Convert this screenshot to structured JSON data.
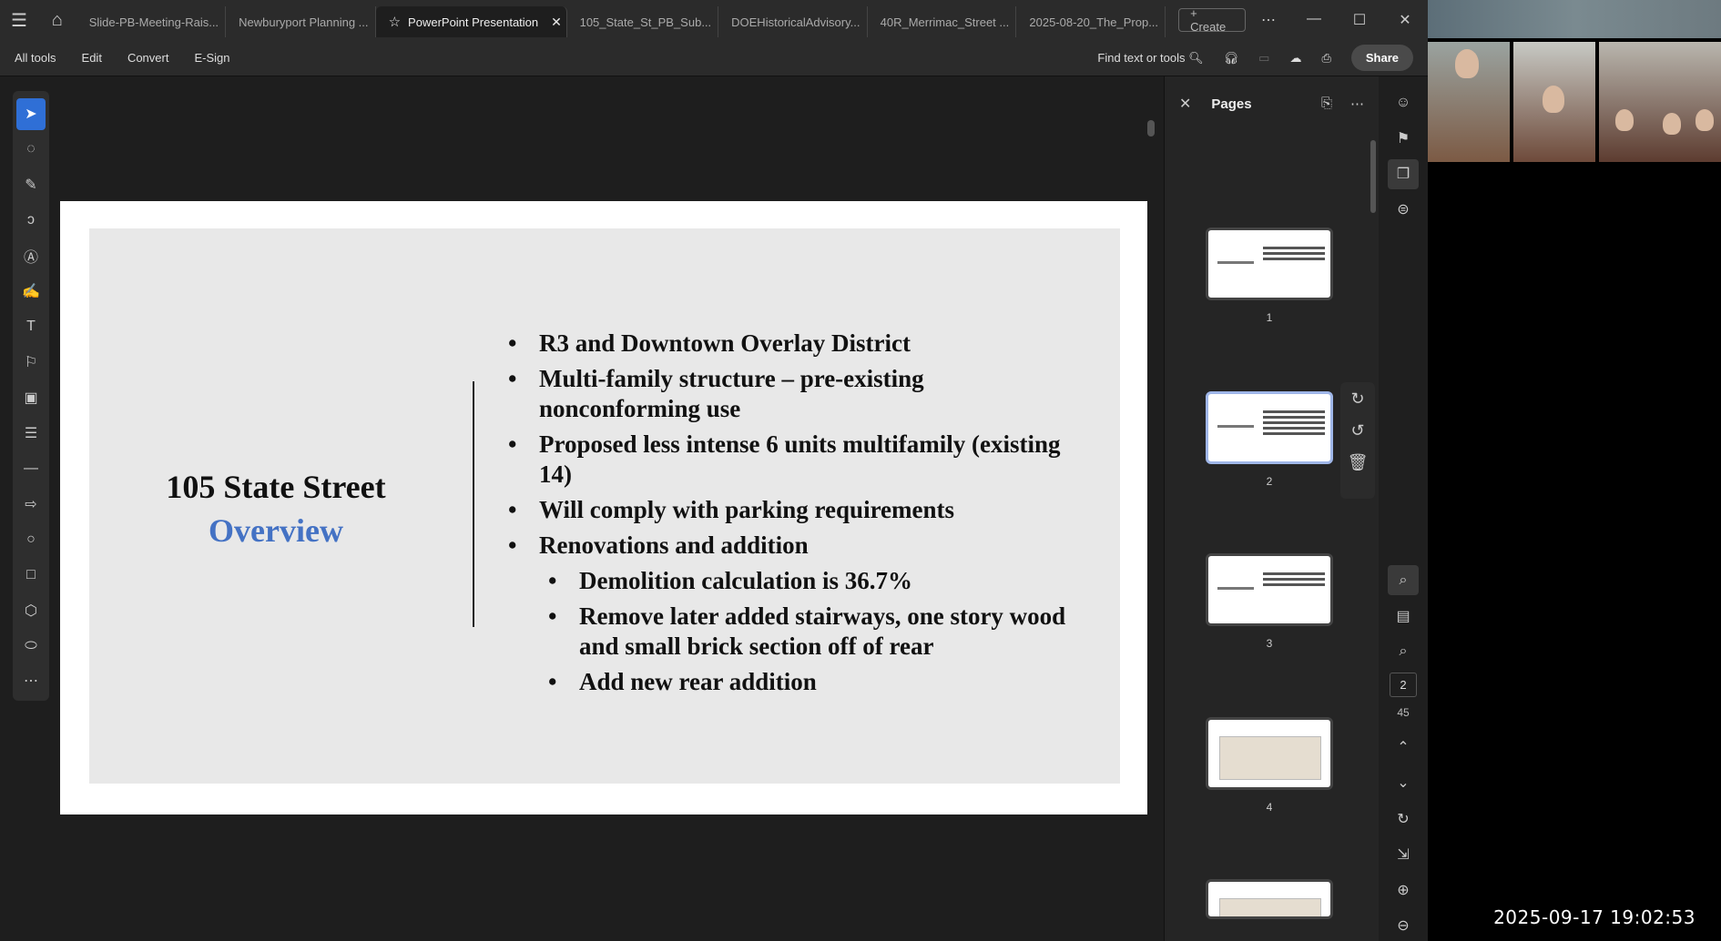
{
  "tabs": [
    {
      "label": "Slide-PB-Meeting-Rais...",
      "active": false
    },
    {
      "label": "Newburyport Planning ...",
      "active": false
    },
    {
      "label": "PowerPoint Presentation",
      "active": true
    },
    {
      "label": "105_State_St_PB_Sub...",
      "active": false
    },
    {
      "label": "DOEHistoricalAdvisory...",
      "active": false
    },
    {
      "label": "40R_Merrimac_Street ...",
      "active": false
    },
    {
      "label": "2025-08-20_The_Prop...",
      "active": false
    }
  ],
  "create_label": "+ Create",
  "menu": {
    "all_tools": "All tools",
    "edit": "Edit",
    "convert": "Convert",
    "esign": "E-Sign",
    "find": "Find text or tools",
    "share": "Share"
  },
  "slide": {
    "title": "105 State Street",
    "subtitle": "Overview",
    "bullets": [
      {
        "text": "R3 and Downtown Overlay District",
        "level": 1
      },
      {
        "text": "Multi-family structure – pre-existing nonconforming use",
        "level": 1
      },
      {
        "text": "Proposed less intense 6 units multifamily (existing 14)",
        "level": 1
      },
      {
        "text": "Will comply with parking requirements",
        "level": 1
      },
      {
        "text": "Renovations and addition",
        "level": 1
      },
      {
        "text": "Demolition calculation is 36.7%",
        "level": 2
      },
      {
        "text": "Remove later added stairways, one story wood and small brick section off of rear",
        "level": 2
      },
      {
        "text": "Add new rear addition",
        "level": 2
      }
    ]
  },
  "pages_panel": {
    "title": "Pages",
    "thumbnails": [
      {
        "num": "1"
      },
      {
        "num": "2",
        "selected": true
      },
      {
        "num": "3"
      },
      {
        "num": "4"
      }
    ]
  },
  "page_nav": {
    "current": "2",
    "total": "45"
  },
  "timestamp": "2025-09-17 19:02:53"
}
